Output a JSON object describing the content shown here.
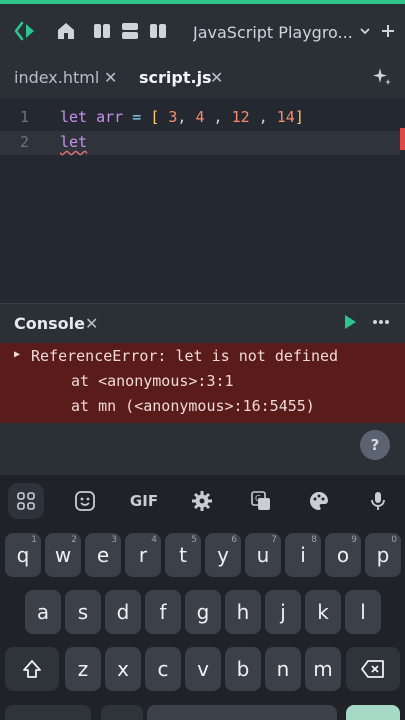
{
  "colors": {
    "accent": "#2dc48d",
    "error_bg": "#5a1b1b",
    "error_mark": "#e04848"
  },
  "toolbar": {
    "logo_icon": "code-brackets-icon",
    "home_icon": "home-icon",
    "layout_icons": [
      "split-vertical-icon",
      "split-horizontal-icon",
      "split-side-icon"
    ],
    "title": "JavaScript Playgro...",
    "dropdown_icon": "chevron-down-icon",
    "add_icon": "plus-icon"
  },
  "tabs": [
    {
      "label": "index.html",
      "close": "✕"
    },
    {
      "label": "script.js",
      "close": "✕"
    }
  ],
  "ai_icon": "sparkle-icon",
  "editor": {
    "lines": [
      {
        "number": "1",
        "tokens": {
          "kw": "let",
          "var": "arr",
          "op": "=",
          "open": "[",
          "n1": "3",
          "n2": "4",
          "n3": "12",
          "n4": "14",
          "close": "]"
        }
      },
      {
        "number": "2",
        "text": "let"
      }
    ]
  },
  "console": {
    "title": "Console",
    "close": "✕",
    "run_icon": "play-icon",
    "more_icon": "more-horizontal-icon",
    "error_lines": [
      "ReferenceError: let is not defined",
      "at <anonymous>:3:1",
      "at mn (<anonymous>:16:5455)"
    ],
    "help_label": "?"
  },
  "keyboard": {
    "toolbar_icons": [
      "apps-grid-icon",
      "sticker-icon",
      "gif-icon",
      "settings-gear-icon",
      "translate-icon",
      "palette-icon",
      "microphone-icon"
    ],
    "gif_label": "GIF",
    "row1": [
      {
        "key": "q",
        "hint": "1"
      },
      {
        "key": "w",
        "hint": "2"
      },
      {
        "key": "e",
        "hint": "3"
      },
      {
        "key": "r",
        "hint": "4"
      },
      {
        "key": "t",
        "hint": "5"
      },
      {
        "key": "y",
        "hint": "6"
      },
      {
        "key": "u",
        "hint": "7"
      },
      {
        "key": "i",
        "hint": "8"
      },
      {
        "key": "o",
        "hint": "9"
      },
      {
        "key": "p",
        "hint": "0"
      }
    ],
    "row2": [
      "a",
      "s",
      "d",
      "f",
      "g",
      "h",
      "j",
      "k",
      "l"
    ],
    "row3": [
      "z",
      "x",
      "c",
      "v",
      "b",
      "n",
      "m"
    ],
    "shift_icon": "shift-icon",
    "backspace_icon": "backspace-icon"
  }
}
